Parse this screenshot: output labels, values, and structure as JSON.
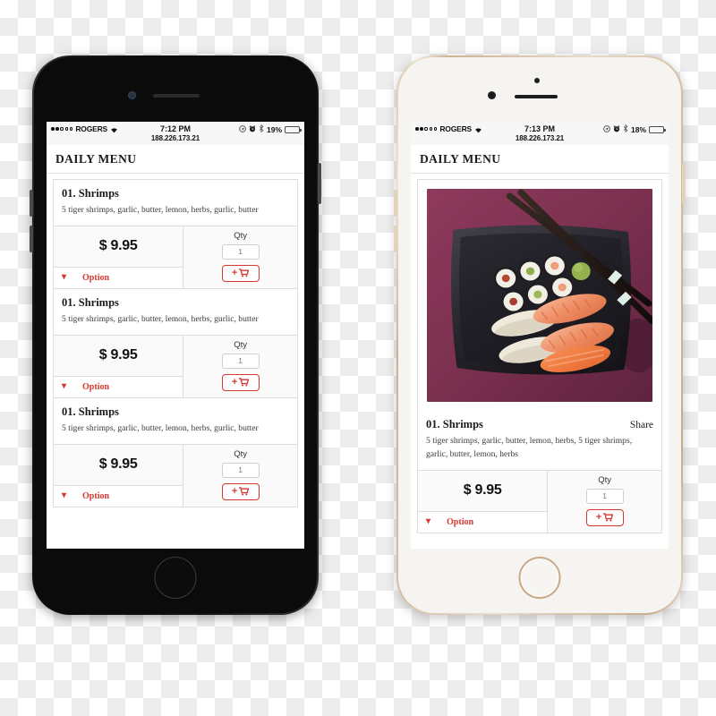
{
  "background": {
    "type": "transparency-checkerboard",
    "color": "#ececec"
  },
  "phones": [
    {
      "id": "black",
      "frame_color": "#0b0b0b",
      "name": "iPhone black — menu list view",
      "status_bar": {
        "signal_dots_filled": 2,
        "signal_dots_empty": 3,
        "carrier": "ROGERS",
        "wifi_icon": "wifi-icon",
        "time": "7:12 PM",
        "ip": "188.226.173.21",
        "icons": [
          "location-arrow-icon",
          "alarm-clock-icon",
          "bluetooth-icon"
        ],
        "battery_percent": "19%",
        "battery_level": 19,
        "battery_color": "#e8392f"
      },
      "header": {
        "title": "DAILY MENU"
      },
      "view": "list",
      "cards": [
        {
          "title": "01. Shrimps",
          "description": "5 tiger shrimps, garlic, butter, lemon, herbs, gurlic, butter",
          "price": "$ 9.95",
          "option_label": "Option",
          "qty_label": "Qty",
          "qty_value": "1",
          "cart_button": "add-to-cart"
        },
        {
          "title": "01. Shrimps",
          "description": "5 tiger shrimps, garlic, butter, lemon, herbs, gurlic, butter",
          "price": "$ 9.95",
          "option_label": "Option",
          "qty_label": "Qty",
          "qty_value": "1",
          "cart_button": "add-to-cart"
        },
        {
          "title": "01. Shrimps",
          "description": "5 tiger shrimps, garlic, butter, lemon, herbs, gurlic, butter",
          "price": "$ 9.95",
          "option_label": "Option",
          "qty_label": "Qty",
          "qty_value": "1",
          "cart_button": "add-to-cart"
        }
      ]
    },
    {
      "id": "white",
      "frame_color": "#e7dbcb",
      "name": "iPhone white/gold — item detail view",
      "status_bar": {
        "signal_dots_filled": 2,
        "signal_dots_empty": 3,
        "carrier": "ROGERS",
        "wifi_icon": "wifi-icon",
        "time": "7:13 PM",
        "ip": "188.226.173.21",
        "icons": [
          "location-arrow-icon",
          "alarm-clock-icon",
          "bluetooth-icon"
        ],
        "battery_percent": "18%",
        "battery_level": 18,
        "battery_color": "#e8392f"
      },
      "header": {
        "title": "DAILY MENU"
      },
      "view": "detail",
      "detail": {
        "photo_alt": "sushi-platter-photo",
        "photo_description": "Assorted sushi and maki on a black square plate with chopsticks on a magenta background",
        "title": "01. Shrimps",
        "share_label": "Share",
        "description": "5 tiger shrimps, garlic, butter, lemon, herbs, 5 tiger shrimps, garlic, butter, lemon, herbs",
        "price": "$ 9.95",
        "option_label": "Option",
        "qty_label": "Qty",
        "qty_value": "1",
        "cart_button": "add-to-cart"
      }
    }
  ],
  "accent": {
    "red": "#d6372f",
    "text": "#1b1b1b",
    "border": "#dddddd"
  }
}
